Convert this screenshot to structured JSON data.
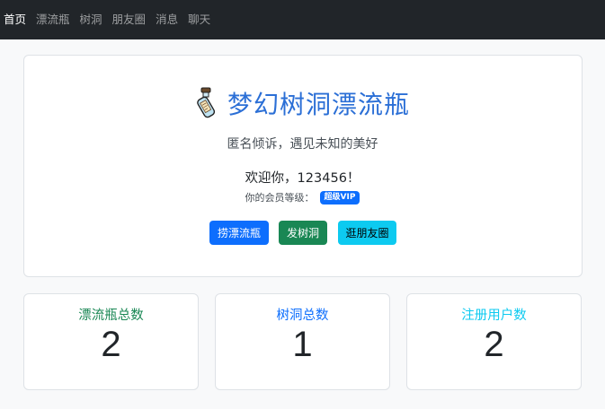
{
  "nav": {
    "items": [
      {
        "label": "首页",
        "active": true
      },
      {
        "label": "漂流瓶",
        "active": false
      },
      {
        "label": "树洞",
        "active": false
      },
      {
        "label": "朋友圈",
        "active": false
      },
      {
        "label": "消息",
        "active": false
      },
      {
        "label": "聊天",
        "active": false
      }
    ]
  },
  "hero": {
    "title": "梦幻树洞漂流瓶",
    "icon": "message-in-a-bottle-icon",
    "tagline": "匿名倾诉，遇见未知的美好",
    "welcome": "欢迎你，123456！",
    "member_label": "你的会员等级：",
    "member_badge": "超级VIP",
    "buttons": {
      "bottle": "捞漂流瓶",
      "treehole": "发树洞",
      "moments": "逛朋友圈"
    }
  },
  "stats": [
    {
      "title": "漂流瓶总数",
      "value": "2",
      "color": "#198754"
    },
    {
      "title": "树洞总数",
      "value": "1",
      "color": "#0d6efd"
    },
    {
      "title": "注册用户数",
      "value": "2",
      "color": "#0dcaf0"
    }
  ],
  "colors": {
    "navbar_bg": "#212529",
    "primary": "#0d6efd",
    "success": "#198754",
    "info": "#0dcaf0",
    "title_blue": "#2b6fd6"
  }
}
